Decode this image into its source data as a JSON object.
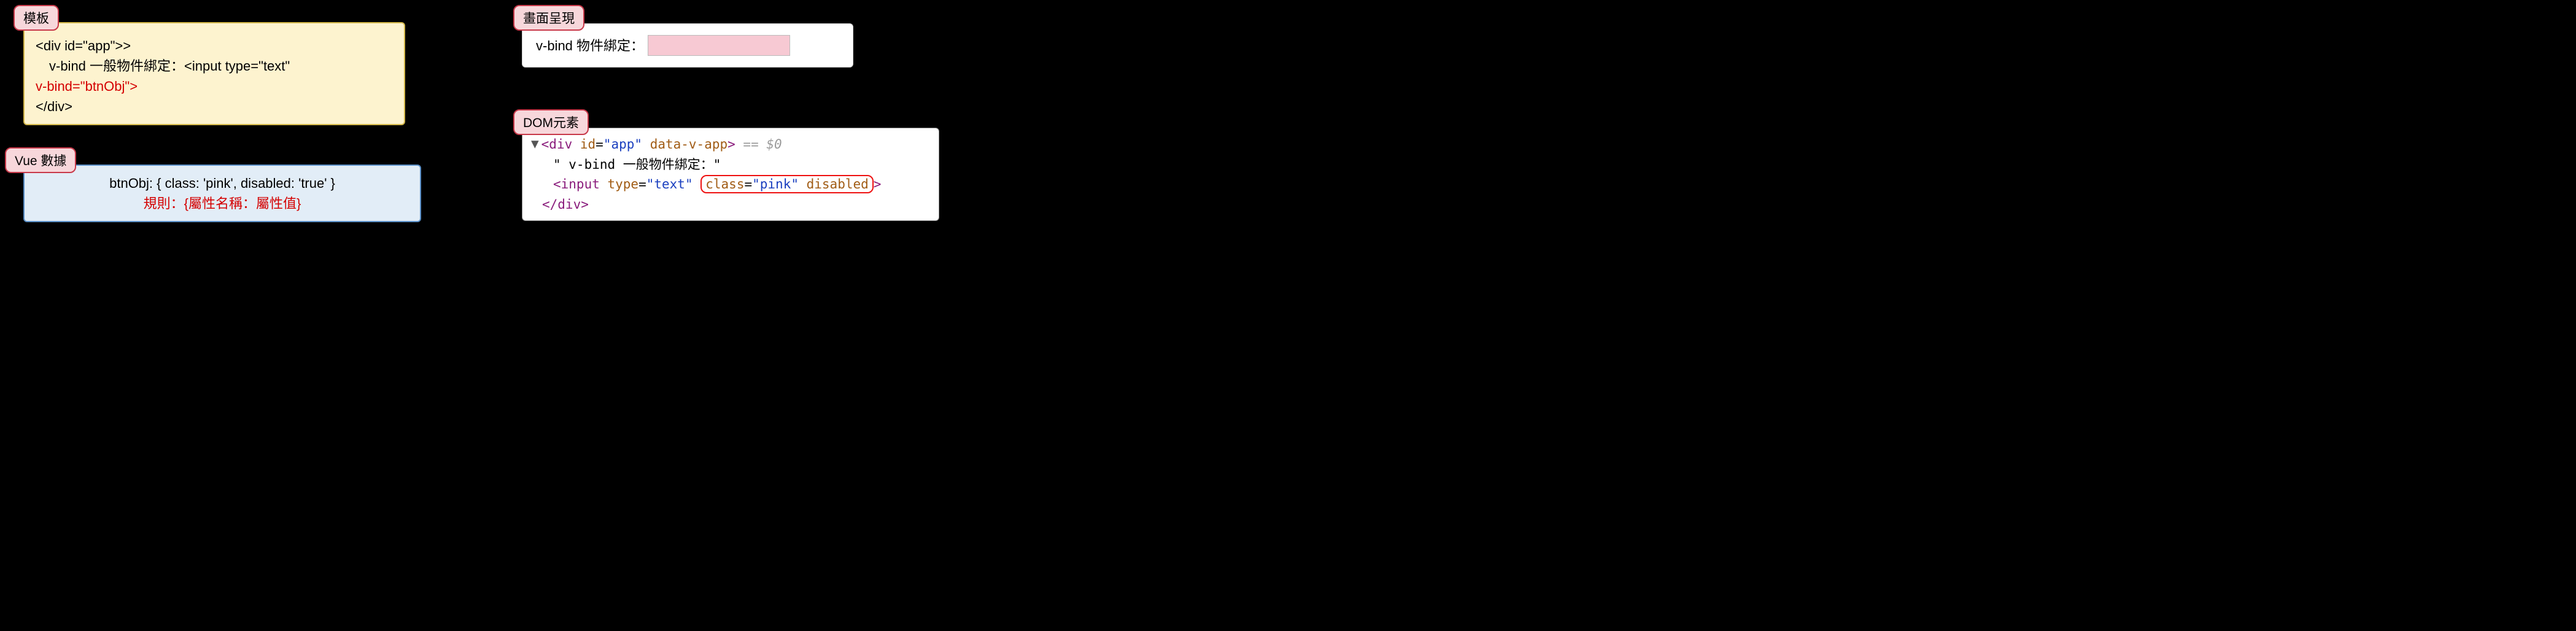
{
  "labels": {
    "template": "模板",
    "vue_data": "Vue 數據",
    "render": "畫面呈現",
    "dom": "DOM元素"
  },
  "template": {
    "line1": "<div id=\"app\">>",
    "line2a": "v-bind 一般物件綁定：<input type=\"text\"",
    "line2b": "v-bind=\"btnObj\">",
    "line3": "</div>"
  },
  "vue_data": {
    "line1": "btnObj: { class: 'pink', disabled: 'true' }",
    "line2": "規則：{屬性名稱：屬性值}"
  },
  "render": {
    "label": "v-bind 物件綁定："
  },
  "dom": {
    "div_open_tag": "<div",
    "div_id_attr": " id",
    "div_id_eq": "=",
    "div_id_val": "\"app\"",
    "div_data_attr": " data-v-app",
    "div_close": ">",
    "eq_s0": " == ",
    "s0": "$0",
    "text_node": "\" v-bind 一般物件綁定：\"",
    "input_open": "<input",
    "type_attr": " type",
    "eq2": "=",
    "type_val": "\"text\"",
    "class_attr": " class",
    "eq3": "=",
    "class_val": "\"pink\"",
    "disabled_attr": " disabled",
    "gt": ">",
    "div_end": "</div>"
  }
}
